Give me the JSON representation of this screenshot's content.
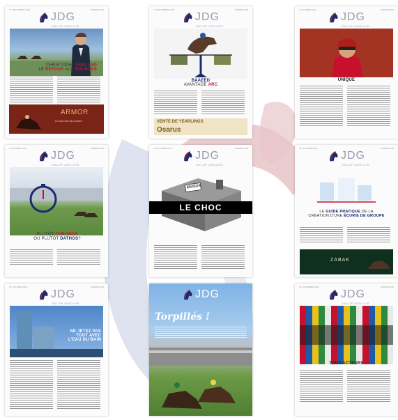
{
  "pages": [
    {
      "caption_1": "CHRISTOPHE",
      "caption_2": "FERLAND",
      "caption_3": "LE",
      "caption_4": "RETOUR",
      "caption_5": "AUX",
      "caption_6": "SOURCES",
      "banner": "ARMOR"
    },
    {
      "caption_1": "BAAEED",
      "caption_2": "AVANTAGE",
      "caption_3": "ARC",
      "banner": "VENTE DE YEARLINGS",
      "brand": "Osarus"
    },
    {
      "caption_1": "UNIQUE"
    },
    {
      "caption_1": "PLUTÔT",
      "caption_2": "CHRONOS",
      "caption_3": "OU PLUTÔT",
      "caption_4": "DATHOS",
      "caption_5": "?"
    },
    {
      "folder": "ENJEUX",
      "caption_1": "LE CHOC"
    },
    {
      "caption_1": "LE",
      "caption_2": "GUIDE PRATIQUE",
      "caption_3": "DE LA",
      "caption_4": "CRÉATION D'UNE",
      "caption_5": "ÉCURIE DE GROUPE",
      "ad": "ZABAK"
    },
    {
      "caption_1": "NE JETEZ PAS",
      "caption_2": "TOUT",
      "caption_3": "AVEC",
      "caption_4": "L'EAU DU BAIN"
    },
    {
      "caption_1": "Torpillés !"
    },
    {
      "caption_1": "TOUS ACTEURS"
    }
  ],
  "logo": {
    "name": "JDG",
    "sub": "GALOP ANGLAIS"
  },
  "colors": {
    "accent": "#c8102e",
    "navy": "#1a2a6c",
    "logo_text": "#9a9ab0"
  }
}
